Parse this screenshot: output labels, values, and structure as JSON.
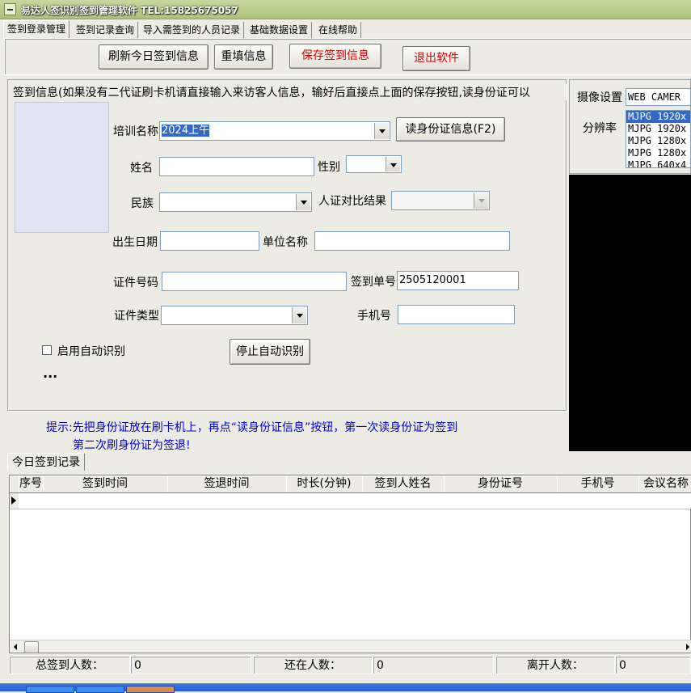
{
  "window": {
    "title": "易达人签识别签到管理软件  TEL:15825675057"
  },
  "tabs": [
    "签到登录管理",
    "签到记录查询",
    "导入需签到的人员记录",
    "基础数据设置",
    "在线帮助"
  ],
  "toolbar": {
    "refresh": "刷新今日签到信息",
    "reset": "重填信息",
    "save": "保存签到信息",
    "exit": "退出软件"
  },
  "signin": {
    "group_title": "签到信息(如果没有二代证刷卡机请直接输入来访客人信息，输好后直接点上面的保存按钮,读身份证可以",
    "training_label": "培训名称",
    "training_value": "2024上午",
    "read_id_button": "读身份证信息(F2)",
    "name_label": "姓名",
    "name_value": "",
    "gender_label": "性别",
    "gender_value": "",
    "ethnic_label": "民族",
    "ethnic_value": "",
    "compare_label": "人证对比结果",
    "compare_value": "",
    "birth_label": "出生日期",
    "birth_value": "",
    "unit_label": "单位名称",
    "unit_value": "",
    "id_label": "证件号码",
    "id_value": "",
    "order_label": "签到单号",
    "order_value": "2505120001",
    "idtype_label": "证件类型",
    "idtype_value": "",
    "phone_label": "手机号",
    "phone_value": "",
    "auto_label": "启用自动识别",
    "stop_button": "停止自动识别",
    "dots": "..."
  },
  "hint": {
    "line1": "提示:先把身份证放在刷卡机上，再点“读身份证信息”按钮，第一次读身份证为签到",
    "line2": "第二次刷身份证为签退!"
  },
  "camera": {
    "device_label": "摄像设置",
    "device_value": "WEB CAMER",
    "resolution_label": "分辨率",
    "resolutions": [
      "MJPG 1920x",
      "MJPG 1920x",
      "MJPG 1280x",
      "MJPG 1280x",
      "MJPG 640x4"
    ]
  },
  "records": {
    "tab": "今日签到记录",
    "columns": [
      "序号",
      "签到时间",
      "签退时间",
      "时长(分钟)",
      "签到人姓名",
      "身份证号",
      "手机号",
      "会议名称"
    ]
  },
  "status": {
    "total_label": "总签到人数：",
    "total_value": "0",
    "present_label": "还在人数：",
    "present_value": "0",
    "left_label": "离开人数：",
    "left_value": "0"
  }
}
